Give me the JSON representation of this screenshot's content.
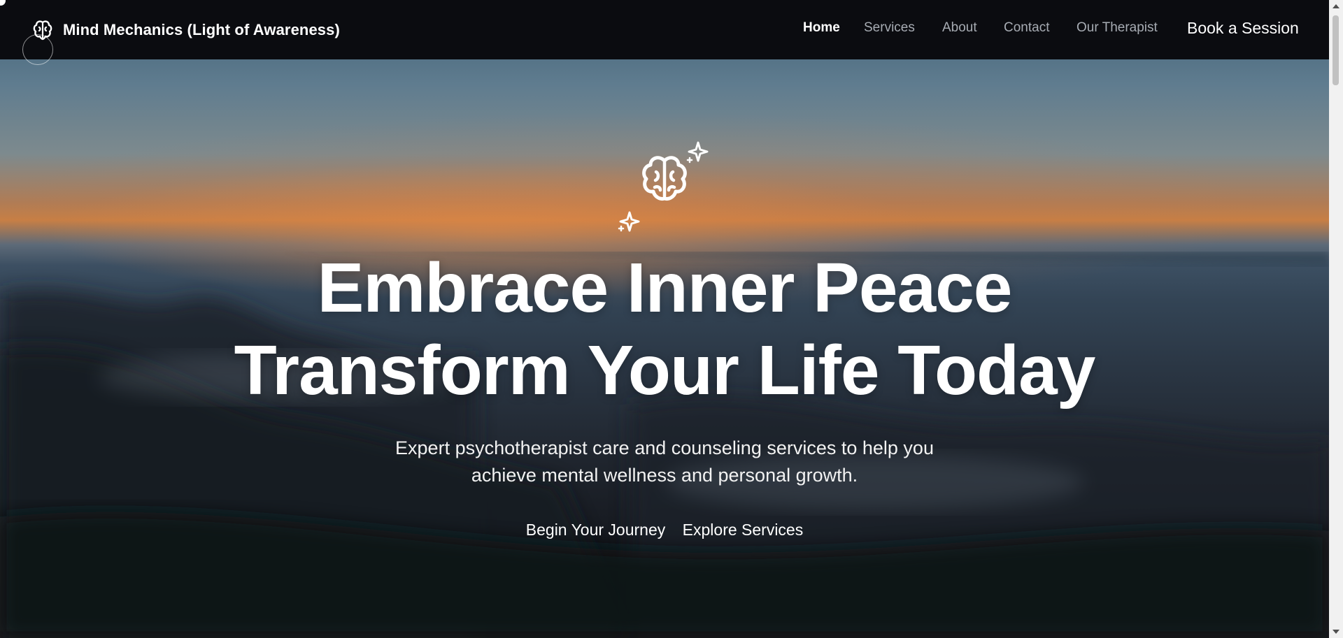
{
  "brand": {
    "name": "Mind Mechanics (Light of Awareness)",
    "icon": "brain-icon"
  },
  "nav": {
    "items": [
      {
        "label": "Home",
        "active": true
      },
      {
        "label": "Services",
        "active": false
      },
      {
        "label": "About",
        "active": false
      },
      {
        "label": "Contact",
        "active": false
      },
      {
        "label": "Our Therapist",
        "active": false
      }
    ],
    "cta_label": "Book a Session"
  },
  "hero": {
    "icon": "brain-sparkles-icon",
    "headline_line1": "Embrace Inner Peace",
    "headline_line2": "Transform Your Life Today",
    "subtitle_line1": "Expert psychotherapist care and counseling services to help you",
    "subtitle_line2": "achieve mental wellness and personal growth.",
    "primary_button": "Begin Your Journey",
    "secondary_button": "Explore Services"
  },
  "colors": {
    "nav_bg": "#0b0c10",
    "nav_link": "#a7acb3",
    "text": "#ffffff"
  }
}
